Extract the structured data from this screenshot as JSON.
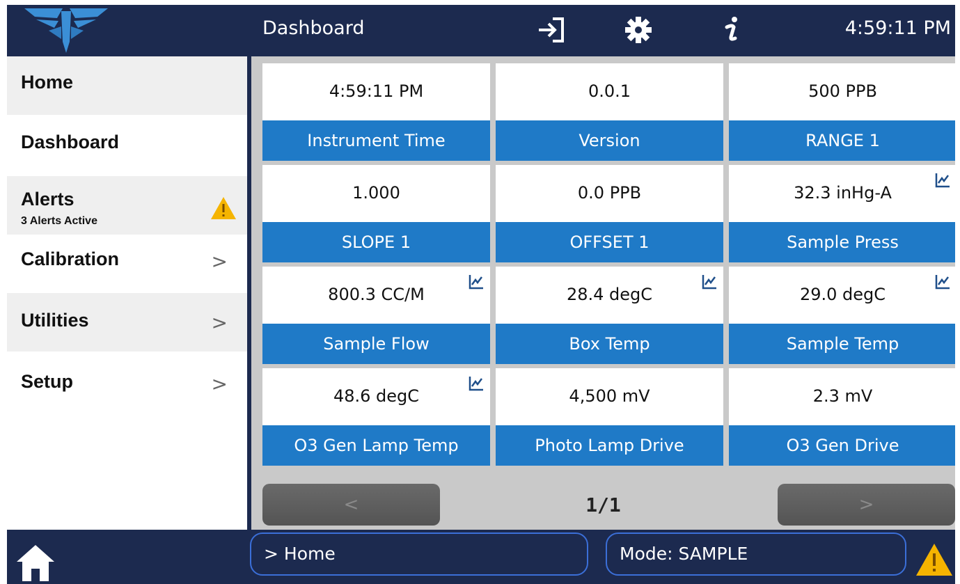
{
  "header": {
    "title": "Dashboard",
    "clock": "4:59:11 PM",
    "icons": [
      "login-icon",
      "gear-icon",
      "info-icon"
    ]
  },
  "sidebar": {
    "items": [
      {
        "label": "Home"
      },
      {
        "label": "Dashboard"
      },
      {
        "label": "Alerts",
        "sub": "3 Alerts Active"
      },
      {
        "label": "Calibration",
        "chevron": ">"
      },
      {
        "label": "Utilities",
        "chevron": ">"
      },
      {
        "label": "Setup",
        "chevron": ">"
      }
    ]
  },
  "tiles": [
    {
      "value": "4:59:11 PM",
      "label": "Instrument Time",
      "trend": false
    },
    {
      "value": "0.0.1",
      "label": "Version",
      "trend": false
    },
    {
      "value": "500 PPB",
      "label": "RANGE 1",
      "trend": false
    },
    {
      "value": "1.000",
      "label": "SLOPE 1",
      "trend": false
    },
    {
      "value": "0.0 PPB",
      "label": "OFFSET 1",
      "trend": false
    },
    {
      "value": "32.3 inHg-A",
      "label": "Sample Press",
      "trend": true
    },
    {
      "value": "800.3 CC/M",
      "label": "Sample Flow",
      "trend": true
    },
    {
      "value": "28.4 degC",
      "label": "Box Temp",
      "trend": true
    },
    {
      "value": "29.0 degC",
      "label": "Sample Temp",
      "trend": true
    },
    {
      "value": "48.6 degC",
      "label": "O3 Gen Lamp Temp",
      "trend": true
    },
    {
      "value": "4,500 mV",
      "label": "Photo Lamp Drive",
      "trend": false
    },
    {
      "value": "2.3 mV",
      "label": "O3 Gen Drive",
      "trend": false
    }
  ],
  "pager": {
    "prev": "<",
    "next": ">",
    "page": "1/1"
  },
  "footer": {
    "breadcrumb": "> Home",
    "mode": "Mode: SAMPLE"
  },
  "colors": {
    "navy": "#1c2a4f",
    "tile_label": "#1f7ac7",
    "warning": "#f5b400",
    "pill_border": "#3b6fd8"
  }
}
